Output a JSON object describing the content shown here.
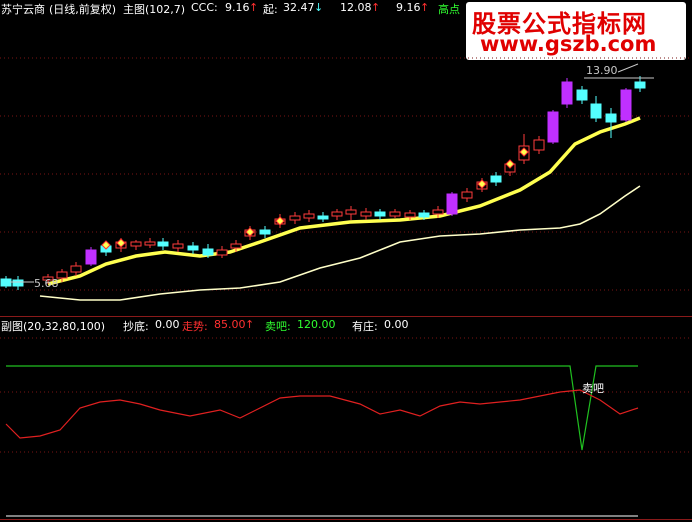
{
  "header": {
    "stock_name": "苏宁云商",
    "period_info": "(日线,前复权)",
    "main_label": "主图(102,7)",
    "ccc_label": "CCC:",
    "ccc_value": "9.16",
    "qi_label": "起:",
    "qi_value": "32.47",
    "val3": "12.08",
    "val4": "9.16",
    "high_label": "高点"
  },
  "watermark": {
    "title": "股票公式指标网",
    "url": "www.gszb.com"
  },
  "main_chart": {
    "high_annotation": "13.90",
    "low_annotation": "5.68"
  },
  "sub_header": {
    "title": "副图(20,32,80,100)",
    "chaodi_label": "抄底:",
    "chaodi_value": "0.00",
    "zoushi_label": "走势:",
    "zoushi_value": "85.00",
    "maiba_label": "卖吧:",
    "maiba_value": "120.00",
    "youzhuang_label": "有庄:",
    "youzhuang_value": "0.00",
    "sell_annotation": "卖吧"
  },
  "colors": {
    "up": "#ff3c3c",
    "down": "#54ffff",
    "ma_thick": "#ffff50",
    "ma_thin": "#ffffc8",
    "trend": "#e02020",
    "sell_line": "#20c020",
    "purple": "#c030ff"
  },
  "chart_data": {
    "type": "candlestick",
    "low_marker": 5.68,
    "high_marker": 13.9,
    "sub_series": [
      {
        "name": "走势",
        "last_value": 85.0
      },
      {
        "name": "卖吧",
        "last_value": 120.0
      },
      {
        "name": "抄底",
        "last_value": 0.0
      },
      {
        "name": "有庄",
        "last_value": 0.0
      }
    ]
  }
}
